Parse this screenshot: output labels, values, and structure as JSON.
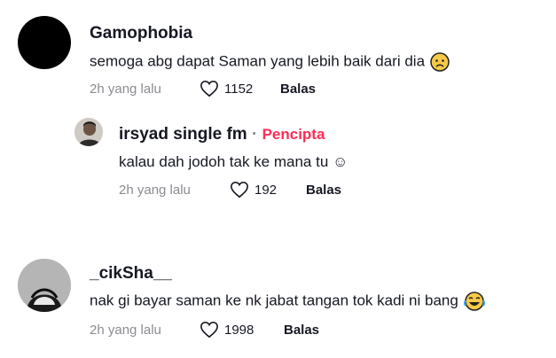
{
  "comments": [
    {
      "username": "Gamophobia",
      "text": "semoga abg dapat Saman yang lebih baik dari dia",
      "emoji": "worried-face",
      "time": "2h yang lalu",
      "likes": "1152",
      "reply_label": "Balas"
    },
    {
      "username": "irsyad single fm",
      "separator": "·",
      "badge": "Pencipta",
      "text": "kalau dah jodoh tak ke mana tu ☺",
      "time": "2h yang lalu",
      "likes": "192",
      "reply_label": "Balas"
    },
    {
      "username": "_cikSha__",
      "text": "nak gi bayar saman ke nk jabat tangan tok kadi ni bang",
      "emoji": "tears-of-joy-face",
      "time": "2h yang lalu",
      "likes": "1998",
      "reply_label": "Balas"
    }
  ],
  "colors": {
    "text": "#161823",
    "muted": "#8a8b91",
    "creator": "#fe2c55",
    "emoji": "#f7c948"
  }
}
